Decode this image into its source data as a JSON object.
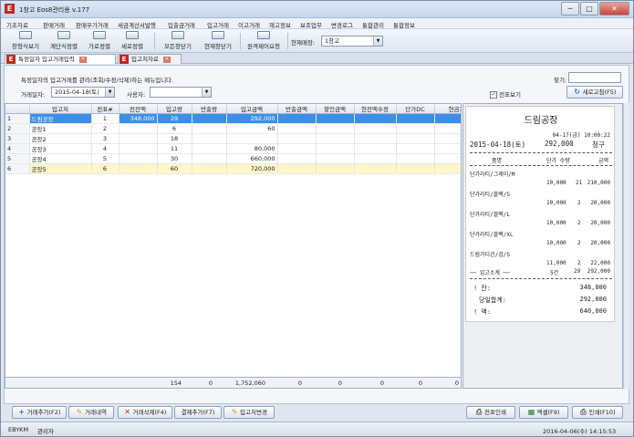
{
  "window": {
    "title": "1창고 Eos8관리용 v.177",
    "min": "─",
    "max": "□",
    "close": "✕"
  },
  "menu": [
    "기초자료",
    "판매거래",
    "판매부가거래",
    "세금계산서발행",
    "입출금거래",
    "입고거래",
    "이고거래",
    "재고정보",
    "보조업무",
    "변경로그",
    "통합관리",
    "통합정보"
  ],
  "toolbar": {
    "buttons": [
      "창형식보기",
      "계단식정렬",
      "가로정렬",
      "세로정렬",
      "모든창닫기",
      "현재창닫기",
      "원격제어요청"
    ],
    "store_label": "현재매장:",
    "store_value": "1창고"
  },
  "tabs": [
    {
      "label": "특정일자 입고거래입력",
      "close": "✕"
    },
    {
      "label": "입고처자료",
      "close": "✕"
    }
  ],
  "page": {
    "description": "특정일자의 입고거래를 관리(조회/수정/삭제)하는 메뉴입니다.",
    "search_label": "찾기:",
    "date_label": "거래일자:",
    "date_value": "2015-04-18(토)",
    "user_label": "사용자:",
    "preview_label": "전표보기",
    "preview_checked": "✓",
    "refresh_label": "새로고침(F5)"
  },
  "grid": {
    "headers": [
      "",
      "입고처",
      "전표#",
      "전잔액",
      "입고량",
      "반출량",
      "입고금액",
      "반출금액",
      "할인금액",
      "현잔액수정",
      "단가DC",
      "현금지급"
    ],
    "rows": [
      {
        "n": "1",
        "name": "드림공장",
        "slip": "1",
        "prev": "348,000",
        "qty": "29",
        "ret": "",
        "amt": "292,000",
        "retamt": "",
        "disc": "",
        "adj": "",
        "dc": "",
        "cash": ""
      },
      {
        "n": "2",
        "name": "공장1",
        "slip": "2",
        "prev": "",
        "qty": "6",
        "ret": "",
        "amt": "60",
        "retamt": "",
        "disc": "",
        "adj": "",
        "dc": "",
        "cash": ""
      },
      {
        "n": "3",
        "name": "공장2",
        "slip": "3",
        "prev": "",
        "qty": "18",
        "ret": "",
        "amt": "",
        "retamt": "",
        "disc": "",
        "adj": "",
        "dc": "",
        "cash": ""
      },
      {
        "n": "4",
        "name": "공장3",
        "slip": "4",
        "prev": "",
        "qty": "11",
        "ret": "",
        "amt": "80,000",
        "retamt": "",
        "disc": "",
        "adj": "",
        "dc": "",
        "cash": ""
      },
      {
        "n": "5",
        "name": "공장4",
        "slip": "5",
        "prev": "",
        "qty": "30",
        "ret": "",
        "amt": "660,000",
        "retamt": "",
        "disc": "",
        "adj": "",
        "dc": "",
        "cash": ""
      },
      {
        "n": "6",
        "name": "공장5",
        "slip": "6",
        "prev": "",
        "qty": "60",
        "ret": "",
        "amt": "720,000",
        "retamt": "",
        "disc": "",
        "adj": "",
        "dc": "",
        "cash": ""
      }
    ],
    "totals": {
      "qty": "154",
      "ret": "0",
      "amt": "1,752,060",
      "retamt": "0",
      "disc": "0",
      "adj": "0",
      "dc": "0",
      "cash": "0"
    }
  },
  "receipt": {
    "title": "드림공장",
    "datetime": "04-17(금) 10:00:22",
    "date": "2015-04-18(토)",
    "amount": "292,000",
    "kind": "청구",
    "head_item": "품명",
    "head_price": "단가 수량",
    "head_amount": "금액",
    "items": [
      {
        "name": "단가라티/그레이/M",
        "price": "10,000",
        "qty": "21",
        "amount": "210,000"
      },
      {
        "name": "단가라티/블랙/S",
        "price": "10,000",
        "qty": "2",
        "amount": "20,000"
      },
      {
        "name": "단가라티/블랙/L",
        "price": "10,000",
        "qty": "2",
        "amount": "20,000"
      },
      {
        "name": "단가라티/블랙/XL",
        "price": "10,000",
        "qty": "2",
        "amount": "20,000"
      },
      {
        "name": "드림가디건/검/S",
        "price": "11,000",
        "qty": "2",
        "amount": "22,000"
      }
    ],
    "subtotal_label": "── 입고소계 ──",
    "subtotal_count": "5건",
    "subtotal_qty": "29",
    "subtotal_amount": "292,000",
    "prev_label": "!    잔:",
    "prev_value": "348,000",
    "total_label": "당일합계:",
    "total_value": "292,000",
    "balance_label": "!    액:",
    "balance_value": "640,000"
  },
  "bottom_buttons": {
    "add": "거래추가(F2)",
    "history": "거래내역",
    "delete": "거래삭제(F4)",
    "settle": "결제추가(F7)",
    "change": "입고처변경",
    "print_slip": "전표인쇄",
    "excel": "엑셀(F9)",
    "print": "인쇄(F10)"
  },
  "status": {
    "code": "EBYKM",
    "user": "관리자",
    "datetime": "2016-04-06(수) 14:15:53"
  },
  "colors": {
    "selection": "#3b8fe8",
    "highlight_row": "#fdf6c9",
    "brand_red": "#c9261f"
  }
}
